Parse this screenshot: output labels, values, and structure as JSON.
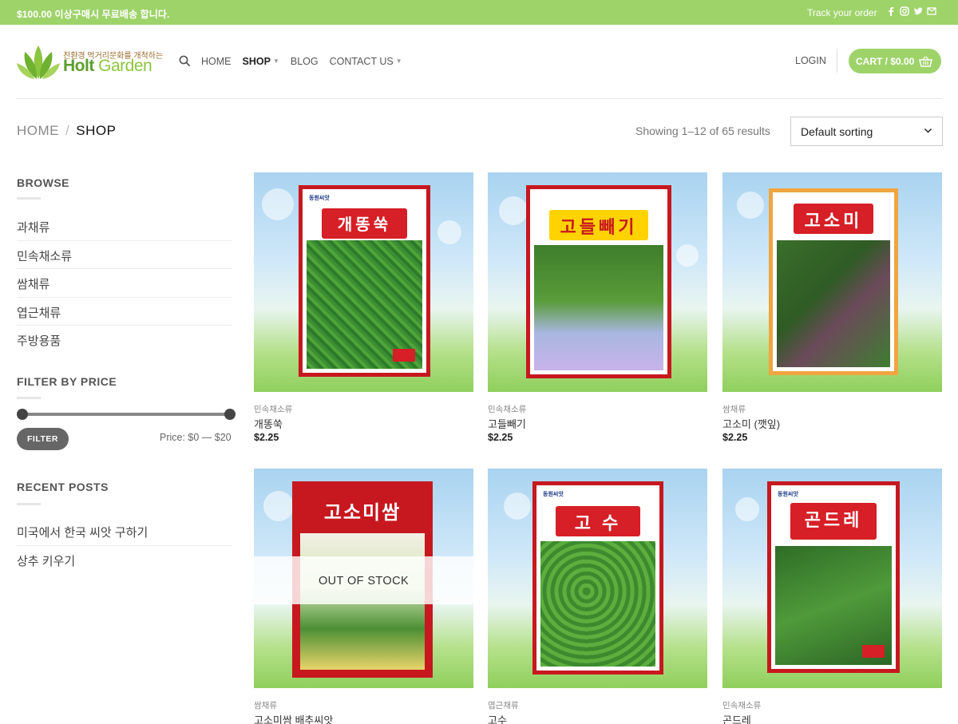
{
  "topbar": {
    "promo": "$100.00 이상구매시 무료배송 합니다.",
    "track": "Track your order",
    "social_icons": [
      "facebook-icon",
      "instagram-icon",
      "twitter-icon",
      "email-icon"
    ]
  },
  "logo": {
    "tagline": "친환경 먹거리문화를 개척하는",
    "name_left": "Holt",
    "name_right": "Garden"
  },
  "nav": {
    "search_icon": "search-icon",
    "items": [
      {
        "label": "HOME",
        "dropdown": false,
        "active": false
      },
      {
        "label": "SHOP",
        "dropdown": true,
        "active": true
      },
      {
        "label": "BLOG",
        "dropdown": false,
        "active": false
      },
      {
        "label": "CONTACT US",
        "dropdown": true,
        "active": false
      }
    ]
  },
  "header_right": {
    "login": "LOGIN",
    "cart": "CART / $0.00",
    "cart_icon": "basket-icon"
  },
  "breadcrumb": {
    "home": "HOME",
    "sep": "/",
    "current": "SHOP"
  },
  "results": {
    "showing": "Showing 1–12 of 65 results",
    "sort_selected": "Default sorting"
  },
  "sidebar": {
    "browse_title": "BROWSE",
    "categories": [
      "과채류",
      "민속채소류",
      "쌈채류",
      "엽근채류",
      "주방용품"
    ],
    "filter_title": "FILTER BY PRICE",
    "price_range": {
      "min": 0,
      "max": 20
    },
    "filter_button": "FILTER",
    "price_label": "Price: $0 — $20",
    "posts_title": "RECENT POSTS",
    "posts": [
      "미국에서 한국 씨앗 구하기",
      "상추 키우기"
    ]
  },
  "products": [
    {
      "category": "민속채소류",
      "title": "개똥쑥",
      "price": "$2.25",
      "packet_title": "개똥쑥",
      "out_of_stock": false
    },
    {
      "category": "민속채소류",
      "title": "고들빼기",
      "price": "$2.25",
      "packet_title": "고들빼기",
      "out_of_stock": false
    },
    {
      "category": "쌈채류",
      "title": "고소미 (깻잎)",
      "price": "$2.25",
      "packet_title": "고소미",
      "out_of_stock": false
    },
    {
      "category": "쌈채류",
      "title": "고소미쌈 배추씨앗",
      "price": "",
      "packet_title": "고소미쌈",
      "out_of_stock": true,
      "badge": "OUT OF STOCK"
    },
    {
      "category": "엽근채류",
      "title": "고수",
      "price": "",
      "packet_title": "고 수",
      "out_of_stock": false
    },
    {
      "category": "민속채소류",
      "title": "곤드레",
      "price": "",
      "packet_title": "곤드레",
      "out_of_stock": false
    }
  ],
  "colors": {
    "brand_green": "#9ed36a",
    "packet_red": "#d61f26",
    "button_gray": "#666666"
  }
}
